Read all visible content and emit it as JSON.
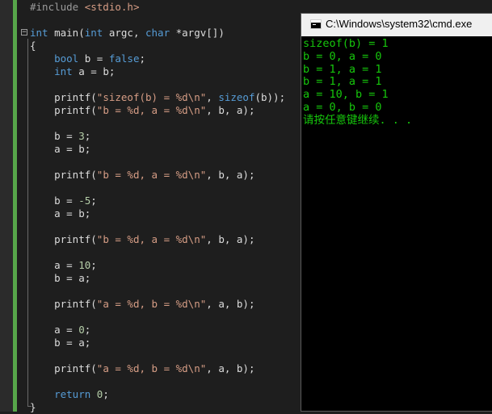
{
  "editor": {
    "lines": [
      [
        {
          "t": "#include ",
          "c": "pp"
        },
        {
          "t": "<stdio.h>",
          "c": "inc"
        }
      ],
      [],
      [
        {
          "t": "int",
          "c": "kw"
        },
        {
          "t": " main("
        },
        {
          "t": "int",
          "c": "kw"
        },
        {
          "t": " argc, "
        },
        {
          "t": "char",
          "c": "kw"
        },
        {
          "t": " *argv[])"
        }
      ],
      [
        {
          "t": "{"
        }
      ],
      [
        {
          "t": "    "
        },
        {
          "t": "bool",
          "c": "kw"
        },
        {
          "t": " b = "
        },
        {
          "t": "false",
          "c": "kw"
        },
        {
          "t": ";"
        }
      ],
      [
        {
          "t": "    "
        },
        {
          "t": "int",
          "c": "kw"
        },
        {
          "t": " a = b;"
        }
      ],
      [],
      [
        {
          "t": "    printf("
        },
        {
          "t": "\"sizeof(b) = %d\\n\"",
          "c": "str"
        },
        {
          "t": ", "
        },
        {
          "t": "sizeof",
          "c": "kw"
        },
        {
          "t": "(b));"
        }
      ],
      [
        {
          "t": "    printf("
        },
        {
          "t": "\"b = %d, a = %d\\n\"",
          "c": "str"
        },
        {
          "t": ", b, a);"
        }
      ],
      [],
      [
        {
          "t": "    b = "
        },
        {
          "t": "3",
          "c": "num"
        },
        {
          "t": ";"
        }
      ],
      [
        {
          "t": "    a = b;"
        }
      ],
      [],
      [
        {
          "t": "    printf("
        },
        {
          "t": "\"b = %d, a = %d\\n\"",
          "c": "str"
        },
        {
          "t": ", b, a);"
        }
      ],
      [],
      [
        {
          "t": "    b = "
        },
        {
          "t": "-5",
          "c": "num"
        },
        {
          "t": ";"
        }
      ],
      [
        {
          "t": "    a = b;"
        }
      ],
      [],
      [
        {
          "t": "    printf("
        },
        {
          "t": "\"b = %d, a = %d\\n\"",
          "c": "str"
        },
        {
          "t": ", b, a);"
        }
      ],
      [],
      [
        {
          "t": "    a = "
        },
        {
          "t": "10",
          "c": "num"
        },
        {
          "t": ";"
        }
      ],
      [
        {
          "t": "    b = a;"
        }
      ],
      [],
      [
        {
          "t": "    printf("
        },
        {
          "t": "\"a = %d, b = %d\\n\"",
          "c": "str"
        },
        {
          "t": ", a, b);"
        }
      ],
      [],
      [
        {
          "t": "    a = "
        },
        {
          "t": "0",
          "c": "num"
        },
        {
          "t": ";"
        }
      ],
      [
        {
          "t": "    b = a;"
        }
      ],
      [],
      [
        {
          "t": "    printf("
        },
        {
          "t": "\"a = %d, b = %d\\n\"",
          "c": "str"
        },
        {
          "t": ", a, b);"
        }
      ],
      [],
      [
        {
          "t": "    "
        },
        {
          "t": "return",
          "c": "kw"
        },
        {
          "t": " "
        },
        {
          "t": "0",
          "c": "num"
        },
        {
          "t": ";"
        }
      ],
      [
        {
          "t": "}"
        }
      ]
    ]
  },
  "console": {
    "title": "C:\\Windows\\system32\\cmd.exe",
    "icon": "cmd-window-icon",
    "output": [
      "sizeof(b) = 1",
      "b = 0, a = 0",
      "b = 1, a = 1",
      "b = 1, a = 1",
      "a = 10, b = 1",
      "a = 0, b = 0",
      "请按任意键继续. . ."
    ]
  },
  "colors": {
    "keyword": "#569cd6",
    "string": "#d69d85",
    "number": "#b5cea8",
    "console_text": "#16c60c",
    "change_bar": "#57a64a"
  }
}
